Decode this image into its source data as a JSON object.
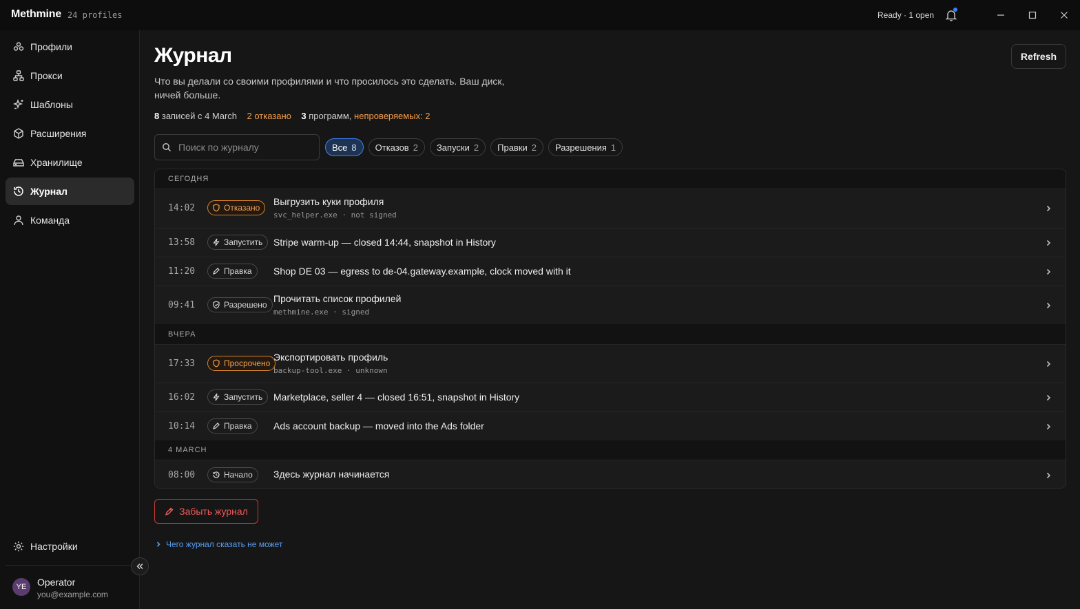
{
  "app": {
    "name": "Methmine",
    "profiles_count": "24 profiles",
    "status": "Ready · 1 open"
  },
  "sidebar": {
    "items": [
      {
        "label": "Профили",
        "icon": "profiles-icon"
      },
      {
        "label": "Прокси",
        "icon": "proxy-icon"
      },
      {
        "label": "Шаблоны",
        "icon": "templates-icon"
      },
      {
        "label": "Расширения",
        "icon": "extensions-icon"
      },
      {
        "label": "Хранилище",
        "icon": "storage-icon"
      },
      {
        "label": "Журнал",
        "icon": "history-icon",
        "active": true
      },
      {
        "label": "Команда",
        "icon": "team-icon"
      }
    ],
    "settings_label": "Настройки",
    "user": {
      "initials": "YE",
      "name": "Operator",
      "email": "you@example.com"
    }
  },
  "page": {
    "title": "Журнал",
    "description": "Что вы делали со своими профилями и что просилось это сделать. Ваш диск, ничей больше.",
    "refresh_label": "Refresh",
    "stats": {
      "records_count": "8",
      "records_text": "записей с 4 March",
      "denied": "2 отказано",
      "programs_count": "3",
      "programs_text": "программ,",
      "unverified": "непроверяемых: 2"
    },
    "search": {
      "placeholder": "Поиск по журналу"
    },
    "filters": [
      {
        "label": "Все",
        "count": "8",
        "active": true
      },
      {
        "label": "Отказов",
        "count": "2"
      },
      {
        "label": "Запуски",
        "count": "2"
      },
      {
        "label": "Правки",
        "count": "2"
      },
      {
        "label": "Разрешения",
        "count": "1"
      }
    ],
    "groups": [
      {
        "label": "СЕГОДНЯ"
      },
      {
        "label": "ВЧЕРА"
      },
      {
        "label": "4 MARCH"
      }
    ],
    "entries": [
      {
        "time": "14:02",
        "badge": "Отказано",
        "title": "Выгрузить куки профиля",
        "sub": "svc_helper.exe · not signed"
      },
      {
        "time": "13:58",
        "badge": "Запустить",
        "title": "Stripe warm-up — closed 14:44, snapshot in History"
      },
      {
        "time": "11:20",
        "badge": "Правка",
        "title": "Shop DE 03 — egress to de-04.gateway.example, clock moved with it"
      },
      {
        "time": "09:41",
        "badge": "Разрешено",
        "title": "Прочитать список профилей",
        "sub": "methmine.exe · signed"
      },
      {
        "time": "17:33",
        "badge": "Просрочено",
        "title": "Экспортировать профиль",
        "sub": "backup-tool.exe · unknown"
      },
      {
        "time": "16:02",
        "badge": "Запустить",
        "title": "Marketplace, seller 4 — closed 16:51, snapshot in History"
      },
      {
        "time": "10:14",
        "badge": "Правка",
        "title": "Ads account backup — moved into the Ads folder"
      },
      {
        "time": "08:00",
        "badge": "Начало",
        "title": "Здесь журнал начинается"
      }
    ],
    "forget_label": "Забыть журнал",
    "explain_label": "Чего журнал сказать не может"
  },
  "colors": {
    "accent": "#3b82f6",
    "warning": "#f59e4a",
    "danger": "#ef5a5a"
  }
}
